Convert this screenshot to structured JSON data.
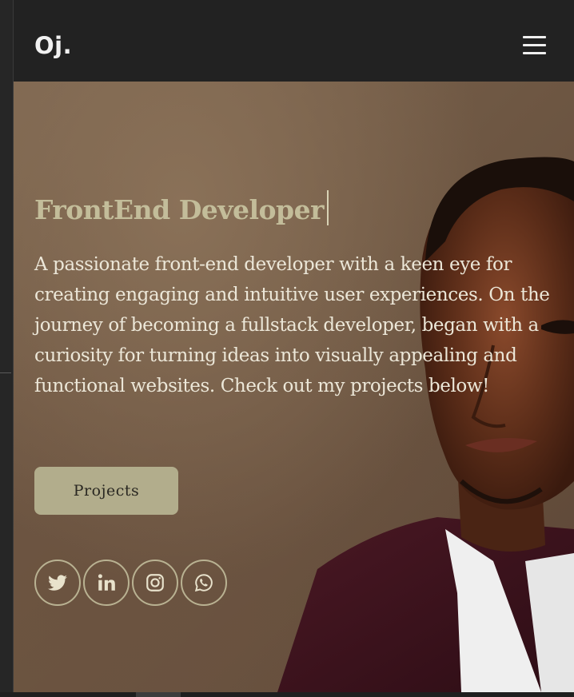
{
  "navbar": {
    "logo": "Oj.",
    "menu_icon": "hamburger-menu-icon"
  },
  "hero": {
    "role": "FrontEnd Developer",
    "intro": "A passionate front-end developer with a keen eye for creating engaging and intuitive user experiences. On the journey of becoming a fullstack developer, began with a curiosity for turning ideas into visually appealing and functional websites. Check out my projects below!",
    "cta_label": "Projects"
  },
  "socials": [
    {
      "name": "twitter",
      "icon": "twitter-icon"
    },
    {
      "name": "linkedin",
      "icon": "linkedin-icon"
    },
    {
      "name": "instagram",
      "icon": "instagram-icon"
    },
    {
      "name": "whatsapp",
      "icon": "whatsapp-icon"
    }
  ],
  "colors": {
    "nav_bg": "#222222",
    "accent": "#b2ad8c",
    "role_text": "#c3bd9a",
    "body_text": "#ece7d8"
  }
}
